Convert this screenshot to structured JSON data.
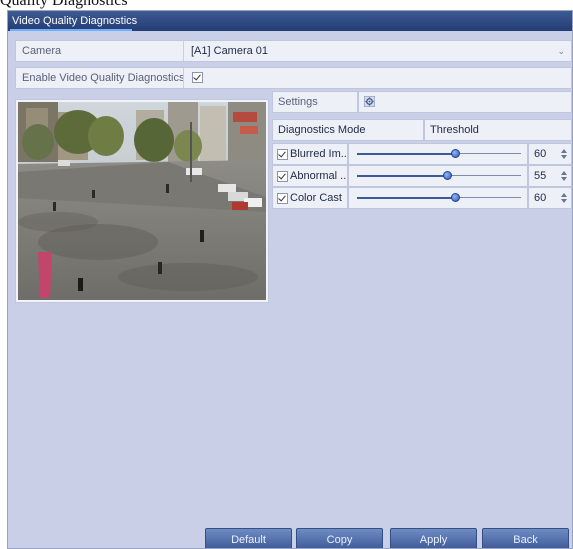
{
  "page_caption": "Quality Diagnostics",
  "window": {
    "tab_title": "Video Quality Diagnostics"
  },
  "camera": {
    "label": "Camera",
    "value": "[A1] Camera 01"
  },
  "enable": {
    "label": "Enable Video Quality Diagnostics",
    "checked": true
  },
  "settings": {
    "label": "Settings"
  },
  "table": {
    "headers": {
      "mode": "Diagnostics Mode",
      "threshold": "Threshold"
    },
    "rows": [
      {
        "label": "Blurred Im...",
        "checked": true,
        "value": "60",
        "level": 0.6
      },
      {
        "label": "Abnormal ...",
        "checked": true,
        "value": "55",
        "level": 0.55
      },
      {
        "label": "Color Cast",
        "checked": true,
        "value": "60",
        "level": 0.6
      }
    ]
  },
  "footer": {
    "default_label": "Default",
    "copy_label": "Copy",
    "apply_label": "Apply",
    "back_label": "Back"
  },
  "colors": {
    "titlebar": "#2f4a84",
    "panel_bg": "#c9cfe6",
    "accent": "#3d5a94"
  }
}
